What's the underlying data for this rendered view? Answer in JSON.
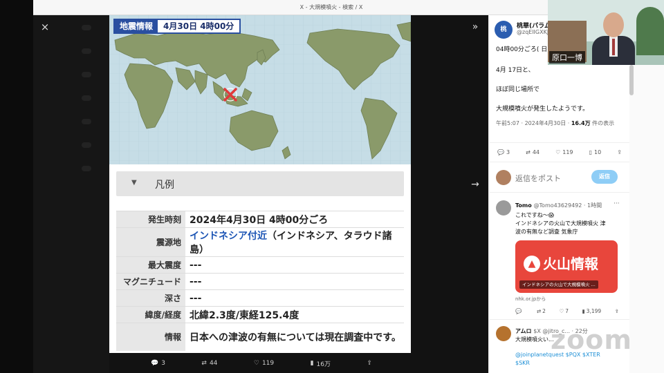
{
  "window": {
    "title": "X - 大規模噴火 - 検索 / X"
  },
  "lightbox": {
    "close": "×",
    "collapse": "»",
    "next": "→"
  },
  "image": {
    "badge_left": "地震情報",
    "badge_right": "4月30日 4時00分",
    "legend_marker": "▼",
    "legend_label": "凡例",
    "rows": [
      {
        "key": "発生時刻",
        "value": "2024年4月30日 4時00分ごろ"
      },
      {
        "key": "震源地",
        "value_link": "インドネシア付近",
        "value": "（インドネシア、タラウド諸島）"
      },
      {
        "key": "最大震度",
        "value": "---"
      },
      {
        "key": "マグニチュード",
        "value": "---"
      },
      {
        "key": "深さ",
        "value": "---"
      },
      {
        "key": "緯度/経度",
        "value": "北緯2.3度/東経125.4度"
      },
      {
        "key": "情報",
        "value": "日本への津波の有無については現在調査中です。"
      }
    ],
    "epicenter_mark": "×"
  },
  "image_actions": {
    "replies": "3",
    "reposts": "44",
    "likes": "119",
    "views": "16万"
  },
  "tweet": {
    "avatar_text": "桃",
    "name": "桃華(パラム",
    "handle": "@zqElIGXKJ",
    "lines": [
      "04時00分ごろ( 日",
      "4月 17日と、",
      "ほぼ同じ場所で",
      "大規模噴火が発生したようです。"
    ],
    "meta_time": "午前5:07 · 2024年4月30日 · ",
    "meta_views": "16.4万",
    "meta_views_suffix": " 件の表示",
    "actions": {
      "replies": "3",
      "reposts": "44",
      "likes": "119",
      "bookmarks": "10"
    },
    "reply_placeholder": "返信をポスト",
    "reply_button": "返信"
  },
  "comments": [
    {
      "name": "Tomo",
      "handle": "@Tomo43629492 · 1時間",
      "lines": [
        "これですね〜😱",
        "インドネシアの火山で大規模噴火 津",
        "波の有無など調査 気象庁"
      ],
      "card_title": "火山情報",
      "card_caption": "インドネシアの火山で大規模噴火 ...",
      "card_source": "nhk.or.jpから",
      "actions": {
        "replies": "",
        "reposts": "2",
        "likes": "7",
        "views": "3,199"
      }
    },
    {
      "name": "アムロ",
      "handle": "$X @jitro_c... · 22分",
      "lines": [
        "大規模噴火い..."
      ],
      "links": [
        "@joinplanetquest $PQX $XTER",
        "$SKR"
      ]
    }
  ],
  "webcam": {
    "label": "原口一博"
  },
  "watermark": "zoom"
}
